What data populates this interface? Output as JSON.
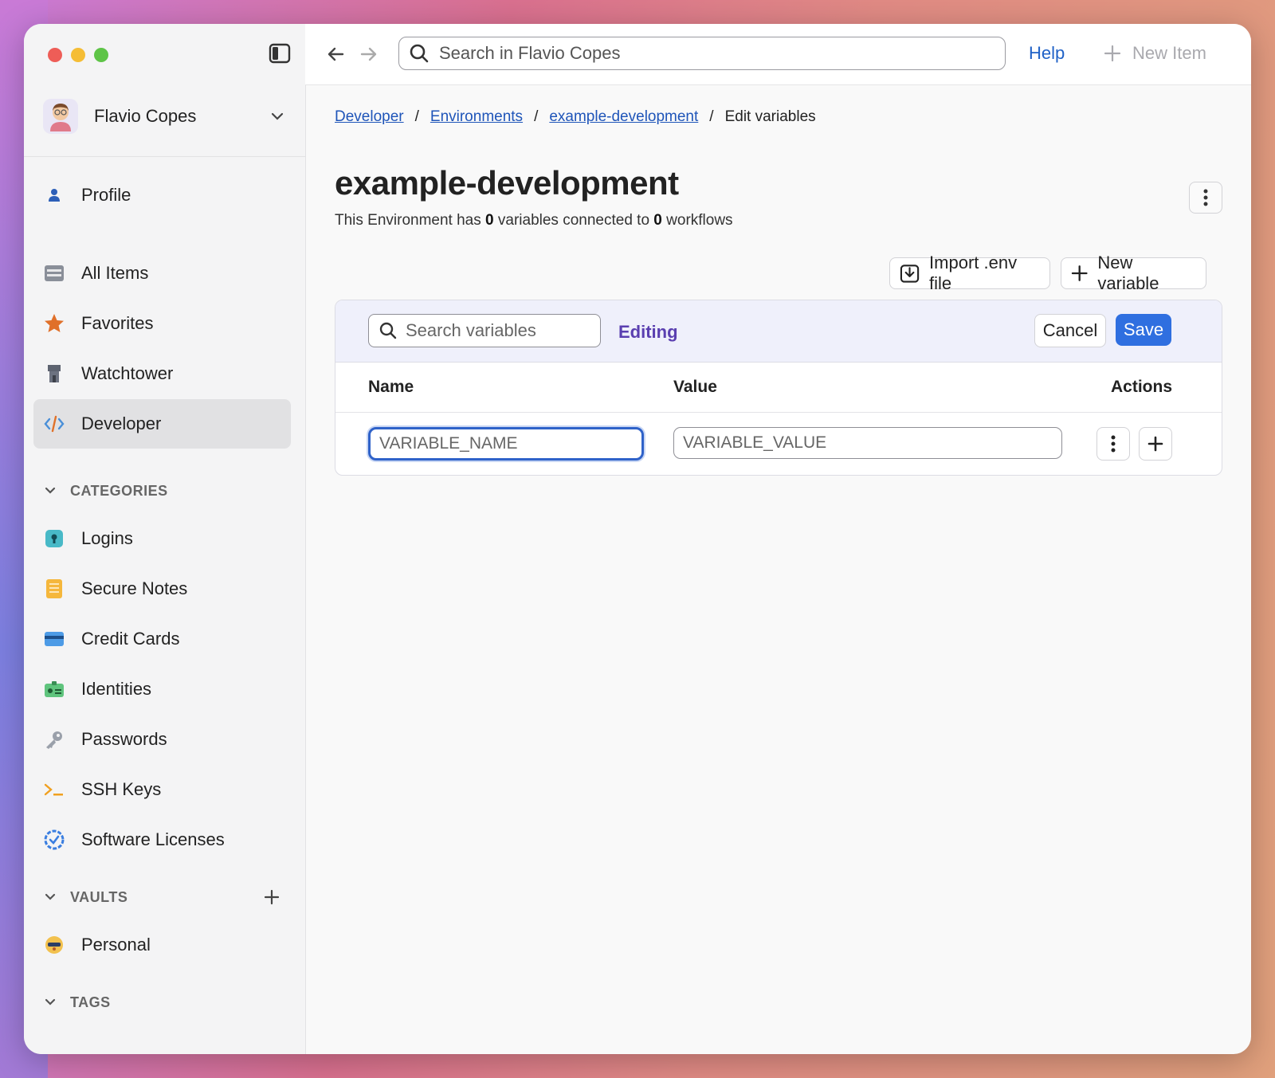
{
  "window": {
    "traffic_lights": [
      "close",
      "minimize",
      "zoom"
    ]
  },
  "sidebar": {
    "account_name": "Flavio Copes",
    "profile_label": "Profile",
    "items": [
      {
        "label": "All Items",
        "icon": "list-icon"
      },
      {
        "label": "Favorites",
        "icon": "star-icon"
      },
      {
        "label": "Watchtower",
        "icon": "tower-icon"
      },
      {
        "label": "Developer",
        "icon": "code-icon",
        "active": true
      }
    ],
    "categories_heading": "CATEGORIES",
    "categories": [
      {
        "label": "Logins",
        "icon": "keyhole-icon"
      },
      {
        "label": "Secure Notes",
        "icon": "note-icon"
      },
      {
        "label": "Credit Cards",
        "icon": "credit-card-icon"
      },
      {
        "label": "Identities",
        "icon": "id-card-icon"
      },
      {
        "label": "Passwords",
        "icon": "key-icon"
      },
      {
        "label": "SSH Keys",
        "icon": "terminal-icon"
      },
      {
        "label": "Software Licenses",
        "icon": "badge-check-icon"
      }
    ],
    "vaults_heading": "VAULTS",
    "vaults": [
      {
        "label": "Personal",
        "icon": "vault-icon"
      }
    ],
    "tags_heading": "TAGS"
  },
  "topbar": {
    "search_placeholder": "Search in Flavio Copes",
    "help_label": "Help",
    "new_item_label": "New Item"
  },
  "breadcrumb": {
    "items": [
      "Developer",
      "Environments",
      "example-development"
    ],
    "current": "Edit variables",
    "separator": "/"
  },
  "page": {
    "title": "example-development",
    "subtitle_prefix": "This Environment has",
    "variables_count": "0",
    "subtitle_mid": "variables connected to",
    "workflows_count": "0",
    "subtitle_suffix": "workflows"
  },
  "actions": {
    "import_label": "Import .env file",
    "new_variable_label": "New variable"
  },
  "editor": {
    "search_placeholder": "Search variables",
    "mode_label": "Editing",
    "cancel_label": "Cancel",
    "save_label": "Save",
    "columns": {
      "name": "Name",
      "value": "Value",
      "actions": "Actions"
    },
    "row": {
      "name_placeholder": "VARIABLE_NAME",
      "value_placeholder": "VARIABLE_VALUE"
    }
  },
  "colors": {
    "accent": "#2f6fe0",
    "link": "#1f55b9",
    "editing": "#5a3fb0"
  }
}
